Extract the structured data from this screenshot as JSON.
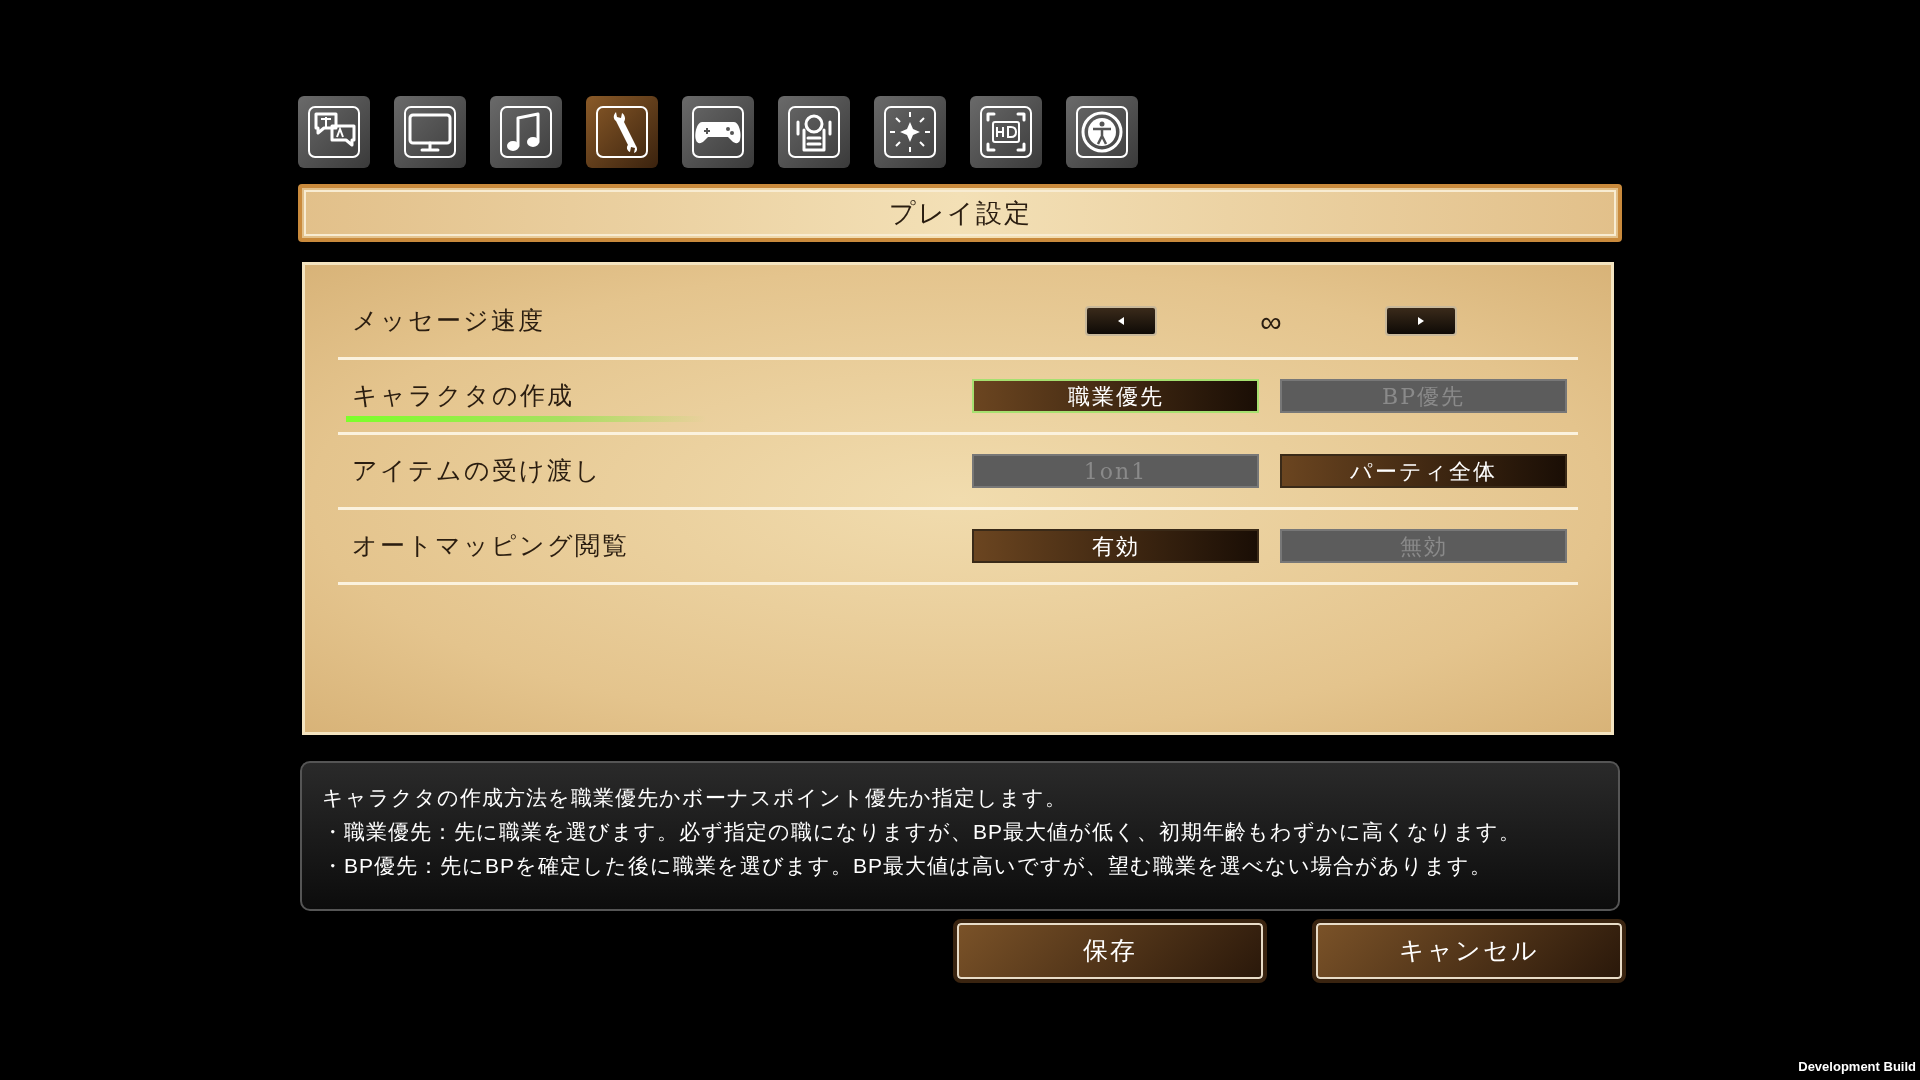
{
  "tabs": [
    {
      "kind": "translate",
      "selected": false
    },
    {
      "kind": "monitor",
      "selected": false
    },
    {
      "kind": "music",
      "selected": false
    },
    {
      "kind": "wrench",
      "selected": true
    },
    {
      "kind": "gamepad",
      "selected": false
    },
    {
      "kind": "machine",
      "selected": false
    },
    {
      "kind": "sparkle",
      "selected": false
    },
    {
      "kind": "hd",
      "selected": false
    },
    {
      "kind": "accessibility",
      "selected": false
    }
  ],
  "title": "プレイ設定",
  "rows": [
    {
      "kind": "stepper",
      "label": "メッセージ速度",
      "value": "∞",
      "focused": false
    },
    {
      "kind": "choice",
      "label": "キャラクタの作成",
      "focused": true,
      "options": [
        {
          "label": "職業優先",
          "selected": true
        },
        {
          "label": "BP優先",
          "selected": false
        }
      ]
    },
    {
      "kind": "choice",
      "label": "アイテムの受け渡し",
      "focused": false,
      "options": [
        {
          "label": "1on1",
          "selected": false
        },
        {
          "label": "パーティ全体",
          "selected": true
        }
      ]
    },
    {
      "kind": "choice",
      "label": "オートマッピング閲覧",
      "focused": false,
      "options": [
        {
          "label": "有効",
          "selected": true
        },
        {
          "label": "無効",
          "selected": false
        }
      ]
    }
  ],
  "description": [
    "キャラクタの作成方法を職業優先かボーナスポイント優先か指定します。",
    "・職業優先：先に職業を選びます。必ず指定の職になりますが、BP最大値が低く、初期年齢もわずかに高くなります。",
    "・BP優先：先にBPを確定した後に職業を選びます。BP最大値は高いですが、望む職業を選べない場合があります。"
  ],
  "buttons": [
    "保存",
    "キャンセル"
  ],
  "build_label": "Development Build"
}
